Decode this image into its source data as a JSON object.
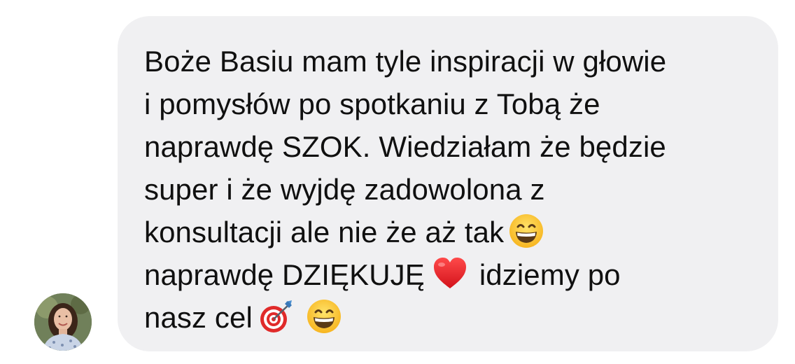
{
  "conversation": {
    "message": {
      "lines": [
        "Boże Basiu mam tyle inspiracji w głowie",
        "i pomysłów po spotkaniu z Tobą że",
        "naprawdę SZOK. Wiedziałam że będzie",
        "super i że wyjdę zadowolona z",
        "konsultacji ale nie że aż tak",
        "naprawdę DZIĘKUJĘ",
        "idziemy po",
        "nasz cel"
      ],
      "emojis": [
        "grinning-face-emoji",
        "red-heart-emoji",
        "direct-hit-emoji",
        "grinning-face-emoji"
      ]
    },
    "avatar": {
      "icon": "profile-photo"
    },
    "colors": {
      "bubble": "#f0f0f2",
      "text": "#101010"
    }
  }
}
